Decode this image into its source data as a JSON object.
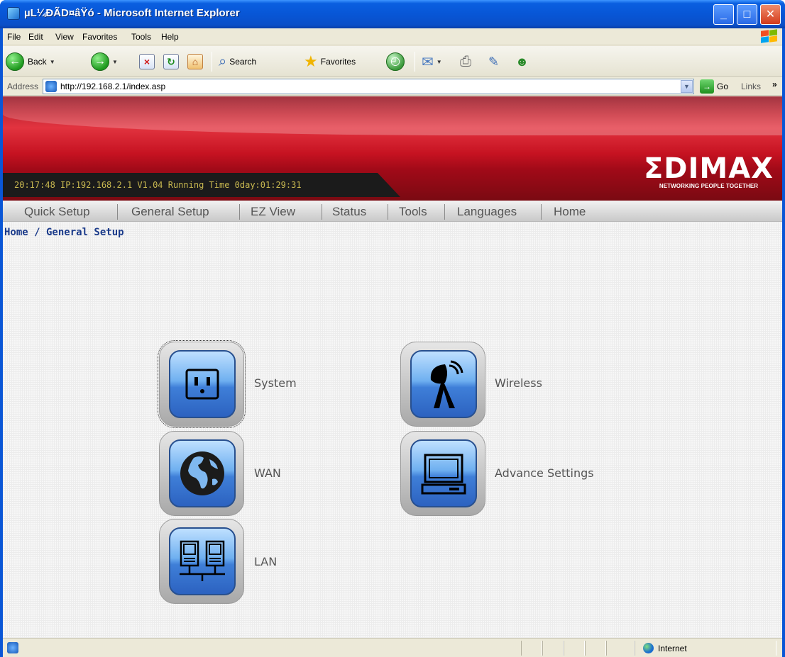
{
  "window": {
    "title": "µL¼ÐÃD¤âŸó - Microsoft Internet Explorer",
    "controls": [
      "minimize",
      "maximize",
      "close"
    ]
  },
  "menubar": {
    "items": [
      "File",
      "Edit",
      "View",
      "Favorites",
      "Tools",
      "Help"
    ]
  },
  "toolbar": {
    "back_label": "Back",
    "search_label": "Search",
    "favorites_label": "Favorites",
    "icons": [
      "back-icon",
      "forward-icon",
      "stop-icon",
      "refresh-icon",
      "home-icon",
      "search-icon",
      "favorites-icon",
      "history-icon",
      "mail-icon",
      "print-icon",
      "edit-icon",
      "messenger-icon"
    ]
  },
  "addressbar": {
    "label": "Address",
    "url": "http://192.168.2.1/index.asp",
    "go_label": "Go",
    "links_label": "Links"
  },
  "banner": {
    "status_line": "20:17:48   IP:192.168.2.1   V1.04   Running Time 0day:01:29:31",
    "logo_text": "ΣDIMAX",
    "logo_tagline": "NETWORKING PEOPLE TOGETHER"
  },
  "nav": {
    "items": [
      "Quick Setup",
      "General Setup",
      "EZ View",
      "Status",
      "Tools",
      "Languages",
      "Home"
    ]
  },
  "breadcrumb": "Home / General Setup",
  "tiles": {
    "system": "System",
    "wireless": "Wireless",
    "wan": "WAN",
    "advance": "Advance Settings",
    "lan": "LAN"
  },
  "statusbar": {
    "zone": "Internet"
  },
  "colors": {
    "banner_red": "#c61221",
    "breadcrumb_blue": "#1a3a8a",
    "tile_blue": "#3f7fd8",
    "xp_title_blue": "#0856d6"
  }
}
